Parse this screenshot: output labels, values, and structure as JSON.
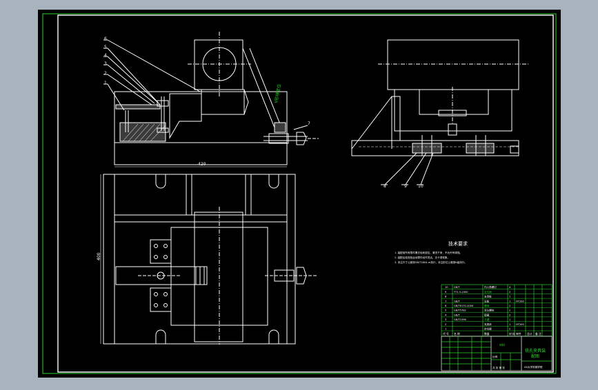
{
  "colors": {
    "app_background": "#a9b3bd",
    "canvas_background": "#000000",
    "line_white": "#ffffff",
    "line_green": "#2ed12e",
    "hatch": "#d0d0d0"
  },
  "drawing": {
    "dimension_width": "420",
    "dimension_height": "400",
    "tech_requirements_title": "技术要求",
    "tech_requirements_lines": [
      "1. 装配前所有零件需去毛刺锐边，清洗干净，不允许有锈蚀。",
      "2. 装配后检查各运动零件动作灵活、无卡滞现象。",
      "3. 未注尺寸公差按GB/T1804-m执行，未注形位公差按K级执行。"
    ],
    "view_label": "A-A 剖视",
    "leader_labels_left": [
      "6",
      "5",
      "4",
      "3",
      "2",
      "1"
    ],
    "leader_label_right": "7",
    "leader_labels_right_view": [
      "8",
      "9",
      "10"
    ]
  },
  "bom": {
    "rows": [
      [
        "GB/T",
        "内六角螺钉",
        "4",
        "",
        "",
        ""
      ],
      [
        "YT1.5-2000",
        "定位销",
        "2",
        "",
        "",
        ""
      ],
      [
        "",
        "支承板",
        "1",
        "",
        "",
        ""
      ],
      [
        "GB/T",
        "压板",
        "1",
        "HT200",
        "",
        ""
      ],
      [
        "GB/T6170-2000",
        "螺母",
        "2",
        "",
        "",
        ""
      ],
      [
        "GB/T5782",
        "双头螺柱",
        "2",
        "",
        "",
        ""
      ],
      [
        "GB/T",
        "垫圈",
        "2",
        "",
        "",
        ""
      ],
      [
        "GB/T1096",
        "平键",
        "1",
        "",
        "",
        ""
      ],
      [
        "",
        "夹具体",
        "1",
        "HT200",
        "",
        ""
      ],
      [
        "",
        "定位键",
        "2",
        "",
        "",
        ""
      ]
    ],
    "header": [
      "代 号",
      "名 称",
      "数量",
      "材 料",
      "单件",
      "总计",
      "备 注"
    ]
  },
  "title_block": {
    "drawing_name_line1": "铣孔夹具装",
    "drawing_name_line2": "配图",
    "company": "XX大学机械学院",
    "scale_label": "比例",
    "sheet_label": "共 张 第 张",
    "material_label": "材料"
  }
}
